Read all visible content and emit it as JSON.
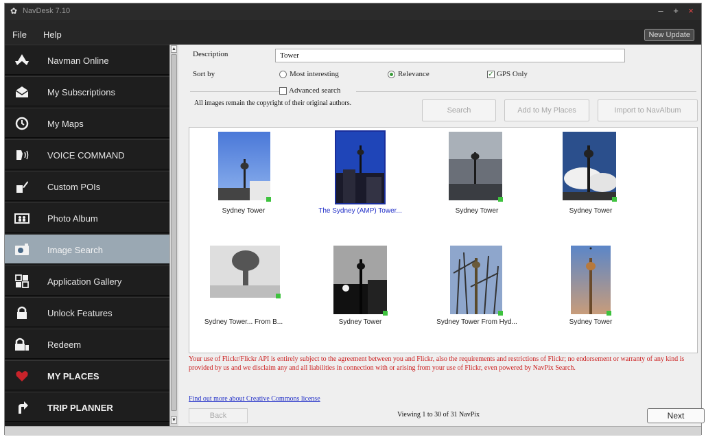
{
  "window": {
    "title": "NavDesk 7.10"
  },
  "menu": {
    "file": "File",
    "help": "Help",
    "new_update": "New Update"
  },
  "sidebar": {
    "items": [
      {
        "label": "Navman Online",
        "icon": "navman-logo-icon"
      },
      {
        "label": "My Subscriptions",
        "icon": "envelope-icon"
      },
      {
        "label": "My Maps",
        "icon": "clock-icon"
      },
      {
        "label": "VOICE COMMAND",
        "icon": "voice-icon"
      },
      {
        "label": "Custom POIs",
        "icon": "pois-icon"
      },
      {
        "label": "Photo Album",
        "icon": "photo-album-icon"
      },
      {
        "label": "Image Search",
        "icon": "camera-icon",
        "active": true
      },
      {
        "label": "Application Gallery",
        "icon": "app-gallery-icon"
      },
      {
        "label": "Unlock Features",
        "icon": "lock-icon"
      },
      {
        "label": "Redeem",
        "icon": "redeem-icon"
      },
      {
        "label": "MY PLACES",
        "icon": "heart-icon"
      },
      {
        "label": "TRIP PLANNER",
        "icon": "trip-arrow-icon"
      }
    ]
  },
  "search": {
    "description_label": "Description",
    "description_value": "Tower",
    "sort_label": "Sort by",
    "sort_most_interesting": "Most interesting",
    "sort_relevance": "Relevance",
    "sort_selected": "Relevance",
    "gps_only_label": "GPS Only",
    "gps_only_checked": true,
    "advanced_label": "Advanced search",
    "advanced_checked": false,
    "copyright_note": "All images remain the copyright of their original authors.",
    "search_button": "Search",
    "add_button": "Add to My Places",
    "import_button": "Import to NavAlbum"
  },
  "results": [
    {
      "caption": "Sydney Tower",
      "selected": false
    },
    {
      "caption": "The Sydney (AMP) Tower...",
      "selected": true
    },
    {
      "caption": "Sydney Tower",
      "selected": false
    },
    {
      "caption": "Sydney Tower",
      "selected": false
    },
    {
      "caption": "Sydney Tower... From B...",
      "selected": false
    },
    {
      "caption": "Sydney Tower",
      "selected": false
    },
    {
      "caption": "Sydney Tower From Hyd...",
      "selected": false
    },
    {
      "caption": "Sydney Tower",
      "selected": false
    }
  ],
  "footer": {
    "terms": "Your use of Flickr/Flickr API is entirely subject to the agreement between you and Flickr, also the requirements and restrictions of Flickr; no endorsement or warranty of any kind is provided by us and we disclaim any and all liabilities in connection with or arising from your use of Flickr, even powered by NavPix Search.",
    "cc_link": "Find out more about Creative Commons license",
    "back_button": "Back",
    "viewing": "Viewing 1 to 30 of 31 NavPix",
    "next_button": "Next"
  },
  "colors": {
    "accent_active": "#9aa8b3",
    "terms_red": "#cc1f1f",
    "link_blue": "#2230c8"
  }
}
